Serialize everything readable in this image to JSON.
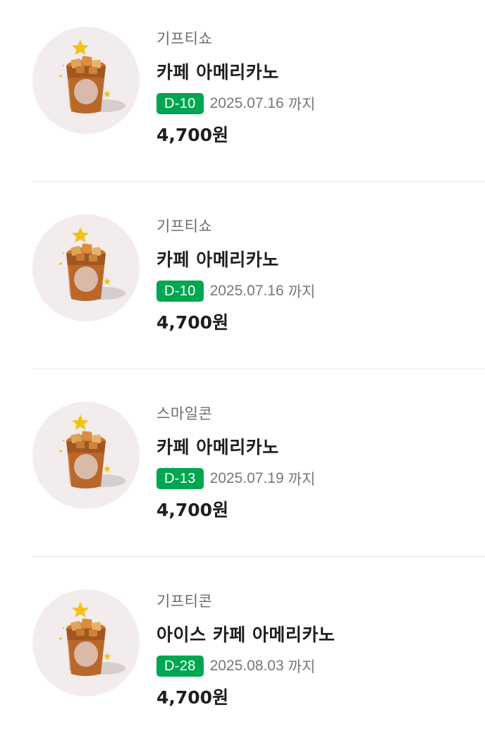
{
  "items": [
    {
      "brand": "기프티쇼",
      "name": "카페 아메리카노",
      "dday": "D-10",
      "expiry_date": "2025.07.16",
      "expiry_suffix": "까지",
      "price": "4,700원",
      "image_icon": "iced-americano-icon"
    },
    {
      "brand": "기프티쇼",
      "name": "카페 아메리카노",
      "dday": "D-10",
      "expiry_date": "2025.07.16",
      "expiry_suffix": "까지",
      "price": "4,700원",
      "image_icon": "iced-americano-icon"
    },
    {
      "brand": "스마일콘",
      "name": "카페 아메리카노",
      "dday": "D-13",
      "expiry_date": "2025.07.19",
      "expiry_suffix": "까지",
      "price": "4,700원",
      "image_icon": "iced-americano-icon"
    },
    {
      "brand": "기프티콘",
      "name": "아이스 카페 아메리카노",
      "dday": "D-28",
      "expiry_date": "2025.08.03",
      "expiry_suffix": "까지",
      "price": "4,700원",
      "image_icon": "iced-americano-icon"
    }
  ],
  "colors": {
    "dday_badge": "#00a650",
    "thumb_background": "#f2ecec",
    "brand_text": "#6b6b6b",
    "title_text": "#1e1e1e"
  }
}
